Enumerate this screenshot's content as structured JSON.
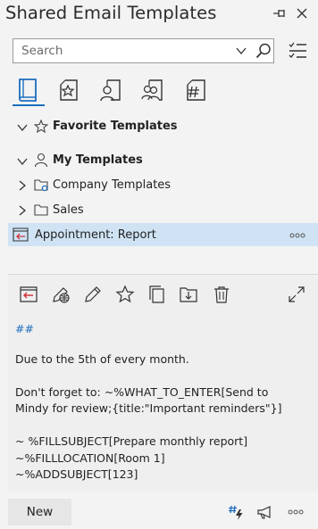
{
  "header": {
    "title": "Shared Email Templates"
  },
  "search": {
    "placeholder": "Search"
  },
  "tabs": [
    {
      "name": "all-templates",
      "icon": "book-icon",
      "active": true
    },
    {
      "name": "favorites",
      "icon": "star-page-icon"
    },
    {
      "name": "my-templates",
      "icon": "person-page-icon"
    },
    {
      "name": "team-templates",
      "icon": "people-page-icon"
    },
    {
      "name": "macros",
      "icon": "hash-page-icon"
    }
  ],
  "tree": {
    "favorite": {
      "label": "Favorite Templates"
    },
    "my": {
      "label": "My Templates"
    },
    "company": {
      "label": "Company Templates"
    },
    "sales": {
      "label": "Sales"
    },
    "selected": {
      "label": "Appointment: Report",
      "more": "ooo"
    }
  },
  "preview": {
    "hash": "##",
    "lines": [
      "Due to the 5th of every month.",
      "",
      "Don't forget to: ~%WHAT_TO_ENTER[Send to",
      "Mindy for review;{title:\"Important reminders\"}]",
      "",
      "~ %FILLSUBJECT[Prepare monthly report]",
      "~%FILLLOCATION[Room 1]",
      "~%ADDSUBJECT[123]"
    ]
  },
  "footer": {
    "new_label": "New",
    "more": "ooo"
  },
  "colors": {
    "accent": "#1d6dbd",
    "selection": "#cfe3f5",
    "insert_red": "#d13438"
  }
}
